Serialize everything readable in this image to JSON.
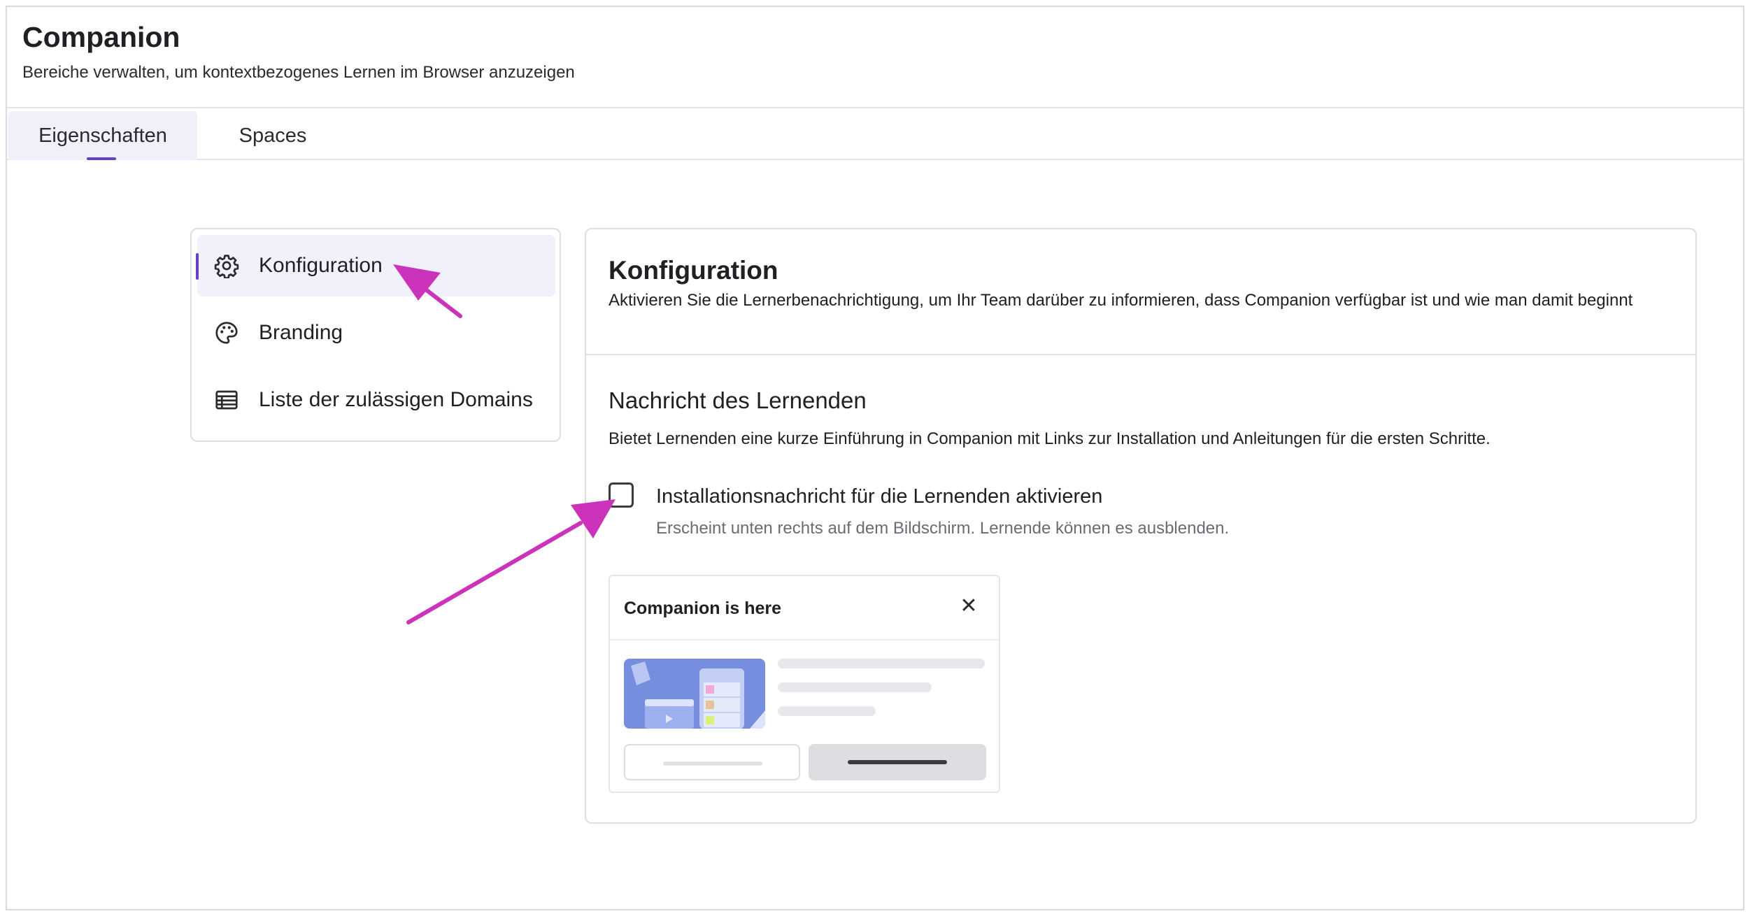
{
  "app": {
    "title": "Companion",
    "subtitle": "Bereiche verwalten, um kontextbezogenes Lernen im Browser anzuzeigen"
  },
  "tabs": [
    {
      "label": "Eigenschaften",
      "active": true
    },
    {
      "label": "Spaces",
      "active": false
    }
  ],
  "sidebar": {
    "items": [
      {
        "label": "Konfiguration",
        "icon": "gear-icon",
        "active": true
      },
      {
        "label": "Branding",
        "icon": "palette-icon",
        "active": false
      },
      {
        "label": "Liste der zulässigen Domains",
        "icon": "table-list-icon",
        "active": false
      }
    ]
  },
  "panel": {
    "title": "Konfiguration",
    "description": "Aktivieren Sie die Lernerbenachrichtigung, um Ihr Team darüber zu informieren, dass Companion verfügbar ist und wie man damit beginnt",
    "section": {
      "title": "Nachricht des Lernenden",
      "description": "Bietet Lernenden eine kurze Einführung in Companion mit Links zur Installation und Anleitungen für die ersten Schritte.",
      "checkbox": {
        "label": "Installationsnachricht für die Lernenden aktivieren",
        "help": "Erscheint unten rechts auf dem Bildschirm. Lernende können es ausblenden.",
        "checked": false
      }
    },
    "preview": {
      "title": "Companion is here",
      "close_icon": "close-icon"
    }
  },
  "colors": {
    "accent": "#6a3fc8",
    "annotation_arrow": "#cc33bb",
    "active_bg": "#f2f0fa"
  }
}
